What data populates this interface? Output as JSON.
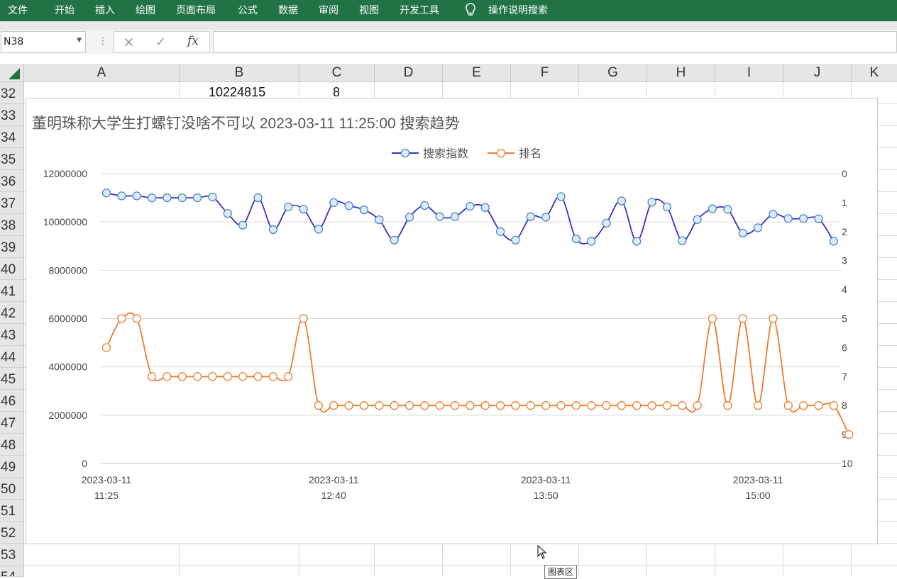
{
  "ribbon": {
    "tabs": [
      "文件",
      "开始",
      "插入",
      "绘图",
      "页面布局",
      "公式",
      "数据",
      "审阅",
      "视图",
      "开发工具"
    ],
    "tell_me": "操作说明搜索",
    "background": "#217346"
  },
  "formula_bar": {
    "name_box": "N38",
    "cancel_icon": "×",
    "enter_icon": "✓",
    "fx_label": "fx",
    "formula": ""
  },
  "sheet": {
    "columns": [
      "A",
      "B",
      "C",
      "D",
      "E",
      "F",
      "G",
      "H",
      "I",
      "J",
      "K"
    ],
    "rows": [
      "32",
      "33",
      "34",
      "35",
      "36",
      "37",
      "38",
      "39",
      "40",
      "41",
      "42",
      "43",
      "44",
      "45",
      "46",
      "47",
      "48",
      "49",
      "50",
      "51",
      "52",
      "53",
      "54"
    ],
    "row32": {
      "B": "10224815",
      "C": "8"
    }
  },
  "chart_data": {
    "type": "line",
    "title": "董明珠称大学生打螺钉没啥不可以 2023-03-11 11:25:00 搜索趋势",
    "legend_position": "top",
    "grid": true,
    "x_tick_labels": [
      [
        "2023-03-11",
        "11:25"
      ],
      [
        "2023-03-11",
        "12:40"
      ],
      [
        "2023-03-11",
        "13:50"
      ],
      [
        "2023-03-11",
        "15:00"
      ]
    ],
    "x_tick_positions": [
      0,
      15,
      29,
      43
    ],
    "y_left": {
      "ticks": [
        "0",
        "2000000",
        "4000000",
        "6000000",
        "8000000",
        "10000000",
        "12000000"
      ],
      "range": [
        0,
        12000000
      ]
    },
    "y_right": {
      "ticks": [
        "0",
        "1",
        "2",
        "3",
        "4",
        "5",
        "6",
        "7",
        "8",
        "9",
        "10"
      ],
      "range": [
        0,
        10
      ],
      "reversed": true
    },
    "series": [
      {
        "name": "搜索指数",
        "axis": "left",
        "color": "#3333cc",
        "marker_fill": "#dcebf7",
        "marker_stroke": "#4f86c6",
        "values": [
          11200000,
          11080000,
          11080000,
          11000000,
          11000000,
          11000000,
          11000000,
          11030000,
          10350000,
          9870000,
          11000000,
          9680000,
          10620000,
          10530000,
          9700000,
          10800000,
          10670000,
          10500000,
          10090000,
          9250000,
          10200000,
          10680000,
          10220000,
          10220000,
          10650000,
          10600000,
          9600000,
          9250000,
          10220000,
          10200000,
          11050000,
          9300000,
          9200000,
          9950000,
          10870000,
          9200000,
          10820000,
          10620000,
          9220000,
          10100000,
          10550000,
          10520000,
          9540000,
          9760000,
          10320000,
          10140000,
          10140000,
          10130000,
          9200000
        ]
      },
      {
        "name": "排名",
        "axis": "right",
        "color": "#ed7d31",
        "marker_fill": "#ffffff",
        "marker_stroke": "#ed7d31",
        "values": [
          6,
          5,
          5,
          7,
          7,
          7,
          7,
          7,
          7,
          7,
          7,
          7,
          7,
          5,
          8,
          8,
          8,
          8,
          8,
          8,
          8,
          8,
          8,
          8,
          8,
          8,
          8,
          8,
          8,
          8,
          8,
          8,
          8,
          8,
          8,
          8,
          8,
          8,
          8,
          8,
          5,
          8,
          5,
          8,
          5,
          8,
          8,
          8,
          8,
          9
        ]
      }
    ]
  },
  "tooltip": "图表区"
}
